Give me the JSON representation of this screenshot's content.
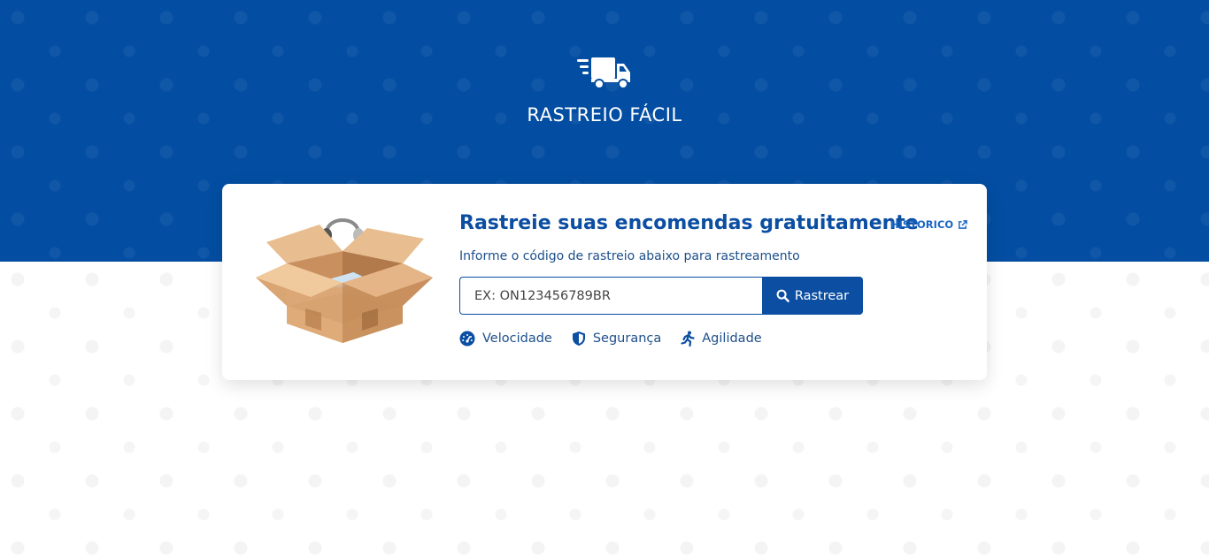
{
  "header": {
    "brand_name": "RASTREIO FÁCIL",
    "logo_icon": "delivery-truck-icon"
  },
  "tracker": {
    "title": "Rastreie suas encomendas gratuitamente",
    "history_link": "HISTORICO",
    "subtitle": "Informe o código de rastreio abaixo para rastreamento",
    "search_placeholder": "EX: ON123456789BR",
    "search_value": "",
    "search_button": "Rastrear",
    "features": [
      {
        "label": "Velocidade",
        "icon": "speedometer-icon"
      },
      {
        "label": "Segurança",
        "icon": "shield-icon"
      },
      {
        "label": "Agilidade",
        "icon": "running-icon"
      }
    ]
  },
  "colors": {
    "brand_blue": "#034ea2",
    "accent_blue": "#0b4ea2",
    "link_blue": "#1a66c4"
  }
}
